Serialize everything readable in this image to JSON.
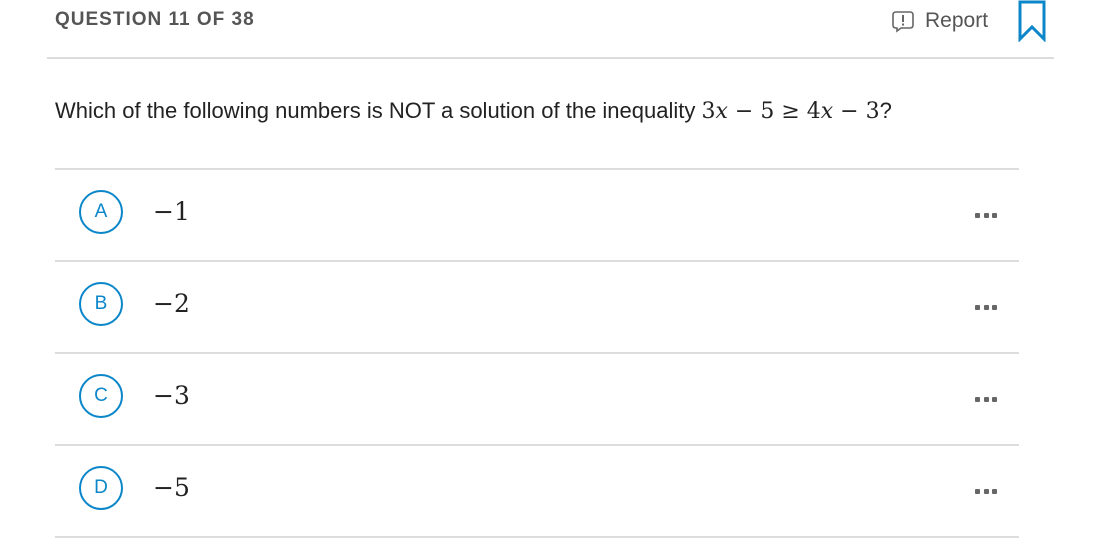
{
  "header": {
    "question_counter": "QUESTION 11 OF 38",
    "report_label": "Report"
  },
  "question": {
    "text": "Which of the following numbers is NOT a solution of the inequality ",
    "math": {
      "lhs_coef": "3",
      "var": "x",
      "lhs_op": " − ",
      "lhs_const": "5",
      "relation": " ≥ ",
      "rhs_coef": "4",
      "rhs_op": " − ",
      "rhs_const": "3"
    },
    "end": "?"
  },
  "choices": [
    {
      "letter": "A",
      "value": "−1"
    },
    {
      "letter": "B",
      "value": "−2"
    },
    {
      "letter": "C",
      "value": "−3"
    },
    {
      "letter": "D",
      "value": "−5"
    }
  ],
  "icons": {
    "report": "report-exclamation-icon",
    "bookmark": "bookmark-icon",
    "more": "more-options-icon"
  },
  "colors": {
    "accent": "#0b86c9",
    "text": "#222222",
    "muted": "#555555",
    "divider": "#dcdcdc"
  }
}
